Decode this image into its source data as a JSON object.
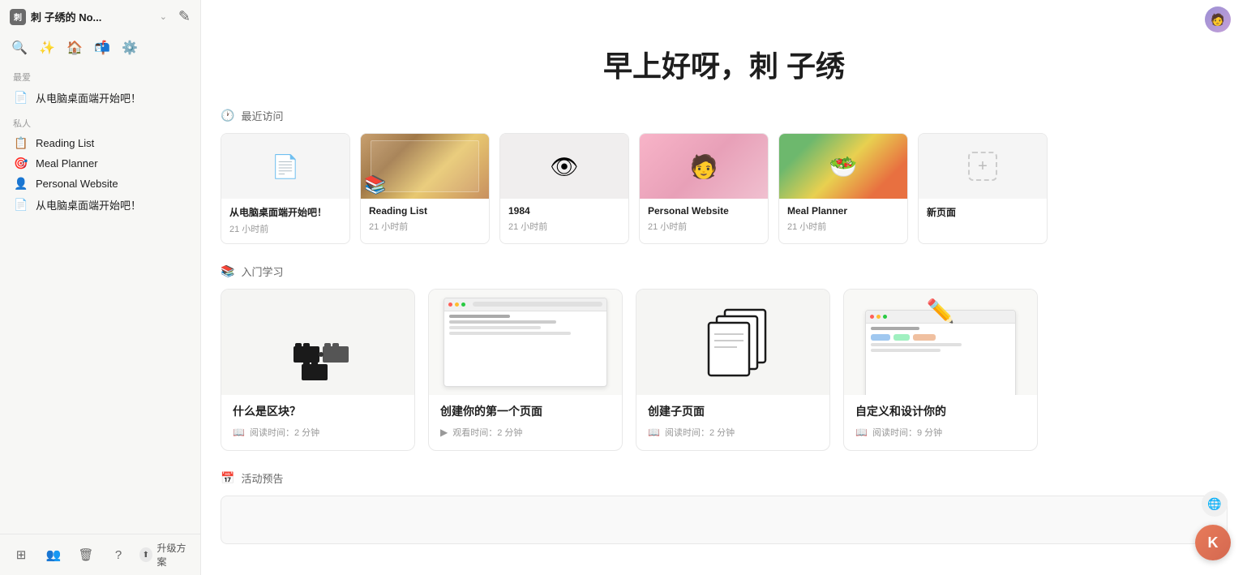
{
  "app": {
    "workspace_name": "刺 子绣的 No...",
    "more_label": "•••"
  },
  "sidebar": {
    "section_favorites_label": "最爱",
    "section_private_label": "私人",
    "favorites_items": [
      {
        "id": "fav-1",
        "icon": "📄",
        "label": "从电脑桌面端开始吧！"
      }
    ],
    "private_items": [
      {
        "id": "reading-list",
        "icon": "📋",
        "label": "Reading List"
      },
      {
        "id": "meal-planner",
        "icon": "🎯",
        "label": "Meal Planner"
      },
      {
        "id": "personal-website",
        "icon": "👤",
        "label": "Personal Website"
      },
      {
        "id": "desktop-start",
        "icon": "📄",
        "label": "从电脑桌面端开始吧！"
      }
    ],
    "bottom_buttons": [
      "⊞",
      "👥",
      "🗑",
      "?"
    ],
    "upgrade_label": "升级方案"
  },
  "main": {
    "greeting": "早上好呀，刺 子绣",
    "recent_section_label": "最近访问",
    "learning_section_label": "入门学习",
    "activity_section_label": "活动预告"
  },
  "recent_cards": [
    {
      "id": "desktop",
      "title": "从电脑桌面端开始吧！",
      "time": "21 小时前",
      "thumb_type": "doc"
    },
    {
      "id": "reading",
      "title": "Reading List",
      "time": "21 小时前",
      "thumb_type": "book"
    },
    {
      "id": "1984",
      "title": "1984",
      "time": "21 小时前",
      "thumb_type": "eye"
    },
    {
      "id": "personal",
      "title": "Personal Website",
      "time": "21 小时前",
      "thumb_type": "person"
    },
    {
      "id": "meal",
      "title": "Meal Planner",
      "time": "21 小时前",
      "thumb_type": "food"
    },
    {
      "id": "new",
      "title": "新页面",
      "time": "",
      "thumb_type": "new"
    }
  ],
  "learn_cards": [
    {
      "id": "blocks",
      "title": "什么是区块？",
      "meta_icon": "📖",
      "meta": "阅读时间：2 分钟",
      "thumb_type": "blocks"
    },
    {
      "id": "first-page",
      "title": "创建你的第一个页面",
      "meta_icon": "▶",
      "meta": "观看时间：2 分钟",
      "thumb_type": "preview"
    },
    {
      "id": "subpage",
      "title": "创建子页面",
      "meta_icon": "📖",
      "meta": "阅读时间：2 分钟",
      "thumb_type": "papers"
    },
    {
      "id": "customize",
      "title": "自定义和设计你的",
      "meta_icon": "📖",
      "meta": "阅读时间：9 分钟",
      "thumb_type": "customize"
    }
  ]
}
